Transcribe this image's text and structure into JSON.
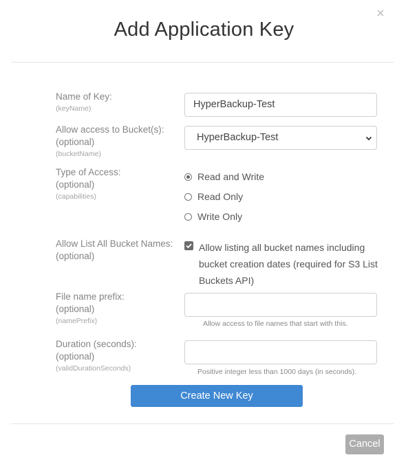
{
  "dialog": {
    "title": "Add Application Key",
    "close_icon": "close-icon"
  },
  "fields": {
    "key_name": {
      "label": "Name of Key:",
      "hint": "(keyName)",
      "value": "HyperBackup-Test"
    },
    "bucket": {
      "label": "Allow access to Bucket(s):",
      "optional": "(optional)",
      "hint": "(bucketName)",
      "selected": "HyperBackup-Test"
    },
    "access_type": {
      "label": "Type of Access:",
      "optional": "(optional)",
      "hint": "(capabilities)",
      "options": [
        {
          "label": "Read and Write",
          "checked": true
        },
        {
          "label": "Read Only",
          "checked": false
        },
        {
          "label": "Write Only",
          "checked": false
        }
      ]
    },
    "list_all": {
      "label": "Allow List All Bucket Names:",
      "optional": "(optional)",
      "checkbox_label": "Allow listing all bucket names including bucket creation dates (required for S3 List Buckets API)",
      "checked": true
    },
    "prefix": {
      "label": "File name prefix:",
      "optional": "(optional)",
      "hint": "(namePrefix)",
      "value": "",
      "help": "Allow access to file names that start with this."
    },
    "duration": {
      "label": "Duration (seconds):",
      "optional": "(optional)",
      "hint": "(validDurationSeconds)",
      "value": "",
      "help": "Positive integer less than 1000 days (in seconds)."
    }
  },
  "buttons": {
    "create": "Create New Key",
    "cancel": "Cancel"
  },
  "colors": {
    "primary": "#3f88d3",
    "cancel": "#adadad"
  }
}
